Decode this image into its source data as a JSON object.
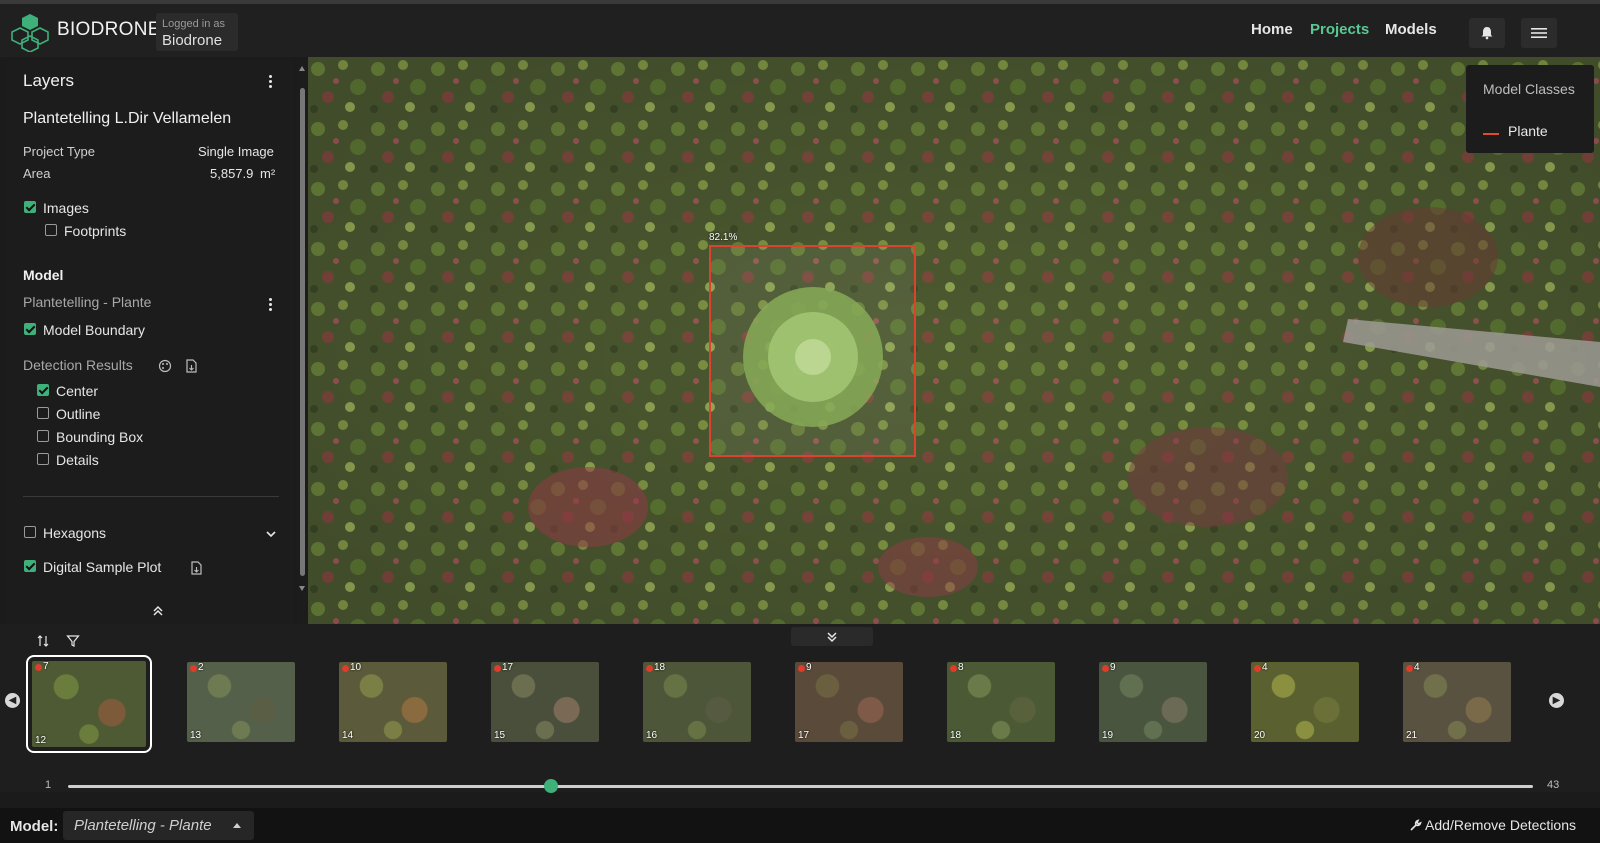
{
  "header": {
    "brand": "BIODRONE",
    "logged_in_label": "Logged in as",
    "user": "Biodrone",
    "nav": [
      {
        "label": "Home"
      },
      {
        "label": "Projects"
      },
      {
        "label": "Models"
      }
    ],
    "icons": [
      "bell-icon",
      "menu-icon"
    ]
  },
  "layers": {
    "title": "Layers",
    "project_name": "Plantetelling L.Dir Vellamelen",
    "project_type_label": "Project Type",
    "project_type_value": "Single Image",
    "area_label": "Area",
    "area_value": "5,857.9",
    "area_unit": "m²",
    "images": {
      "label": "Images",
      "checked": true
    },
    "footprints": {
      "label": "Footprints",
      "checked": false
    },
    "model_heading": "Model",
    "model_name": "Plantetelling - Plante",
    "model_boundary": {
      "label": "Model Boundary",
      "checked": true
    },
    "detection_results_label": "Detection Results",
    "detection_options": [
      {
        "label": "Center",
        "checked": true
      },
      {
        "label": "Outline",
        "checked": false
      },
      {
        "label": "Bounding Box",
        "checked": false
      },
      {
        "label": "Details",
        "checked": false
      }
    ],
    "hexagons": {
      "label": "Hexagons",
      "checked": false
    },
    "digital_sample_plot": {
      "label": "Digital Sample Plot",
      "checked": true
    }
  },
  "map": {
    "detection_confidence": "82.1%",
    "detection_color": "#d9442e",
    "model_classes_title": "Model Classes",
    "classes": [
      {
        "name": "Plante",
        "color": "#e04a2f"
      }
    ]
  },
  "filmstrip": {
    "thumbnails": [
      {
        "count": "7",
        "number": "12",
        "selected": true
      },
      {
        "count": "2",
        "number": "13",
        "selected": false
      },
      {
        "count": "10",
        "number": "14",
        "selected": false
      },
      {
        "count": "17",
        "number": "15",
        "selected": false
      },
      {
        "count": "18",
        "number": "16",
        "selected": false
      },
      {
        "count": "9",
        "number": "17",
        "selected": false
      },
      {
        "count": "8",
        "number": "18",
        "selected": false
      },
      {
        "count": "9",
        "number": "19",
        "selected": false
      },
      {
        "count": "4",
        "number": "20",
        "selected": false
      },
      {
        "count": "4",
        "number": "21",
        "selected": false
      }
    ],
    "slider_min": "1",
    "slider_max": "43",
    "slider_position_fraction": 0.33,
    "accent": "#3fb07a"
  },
  "footer": {
    "model_label": "Model:",
    "model_selected": "Plantetelling - Plante",
    "edit_label": "Add/Remove Detections"
  }
}
